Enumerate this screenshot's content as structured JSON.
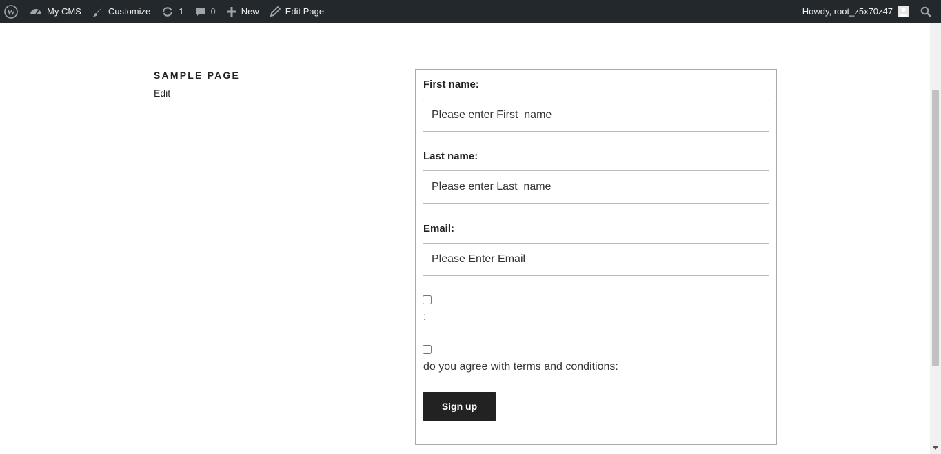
{
  "adminbar": {
    "site_name": "My CMS",
    "customize": "Customize",
    "updates_count": "1",
    "comments_count": "0",
    "new_label": "New",
    "edit_page": "Edit Page",
    "howdy": "Howdy, root_z5x70z47"
  },
  "icons": {
    "wordpress": "wordpress-icon",
    "dashboard": "dashboard-icon",
    "customize": "brush-icon",
    "updates": "refresh-icon",
    "comments": "comment-icon",
    "new": "plus-icon",
    "edit": "pencil-icon",
    "avatar": "avatar-icon",
    "search": "search-icon"
  },
  "page": {
    "title": "SAMPLE PAGE",
    "edit_link": "Edit"
  },
  "form": {
    "first_name_label": "First name:",
    "first_name_placeholder": "Please enter First  name",
    "last_name_label": "Last name:",
    "last_name_placeholder": "Please enter Last  name",
    "email_label": "Email:",
    "email_placeholder": "Please Enter Email",
    "checkbox1_label": ":",
    "checkbox2_label": "do you agree with terms and conditions:",
    "submit_label": "Sign up"
  },
  "colors": {
    "adminbar_bg": "#23282d",
    "button_bg": "#222222"
  }
}
